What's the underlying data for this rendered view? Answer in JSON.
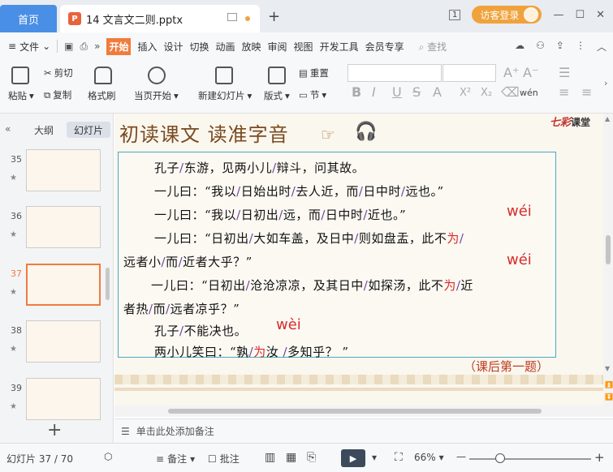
{
  "titlebar": {
    "home_label": "首页",
    "doc_icon": "P",
    "doc_name": "14 文言文二则.pptx",
    "new_tab": "+",
    "page_indicator": "1",
    "login_label": "访客登录",
    "minimize": "—",
    "maximize": "☐",
    "close": "✕"
  },
  "menubar": {
    "file_label": "文件",
    "tabs": [
      "开始",
      "插入",
      "设计",
      "切换",
      "动画",
      "放映",
      "审阅",
      "视图",
      "开发工具",
      "会员专享"
    ],
    "search_label": "查找"
  },
  "ribbon": {
    "paste": "粘贴",
    "cut": "剪切",
    "copy": "复制",
    "format_painter": "格式刷",
    "play_from_current": "当页开始",
    "new_slide": "新建幻灯片",
    "layout": "版式",
    "reset": "重置",
    "section": "节",
    "font_buttons": [
      "B",
      "I",
      "U",
      "S",
      "A",
      "X²",
      "X₂"
    ],
    "wen_label": "wén"
  },
  "leftpanel": {
    "collapse_icon": "«",
    "outline_tab": "大纲",
    "slides_tab": "幻灯片",
    "slides": [
      {
        "num": "35",
        "active": false
      },
      {
        "num": "36",
        "active": false
      },
      {
        "num": "37",
        "active": true
      },
      {
        "num": "38",
        "active": false
      },
      {
        "num": "39",
        "active": false
      }
    ],
    "add_slide": "+"
  },
  "slide": {
    "title": "初读课文 读准字音",
    "logo_main": "七彩",
    "logo_sub": "课堂",
    "lines": [
      {
        "parts": [
          [
            "孔子",
            "t"
          ],
          [
            "/",
            "s"
          ],
          [
            "东游，见两小儿",
            "t"
          ],
          [
            "/",
            "s"
          ],
          [
            "辩斗，问其故。",
            "t"
          ]
        ]
      },
      {
        "parts": [
          [
            "一儿曰：“我以",
            "t"
          ],
          [
            "/",
            "s"
          ],
          [
            "日始出时",
            "t"
          ],
          [
            "/",
            "s"
          ],
          [
            "去人近，而",
            "t"
          ],
          [
            "/",
            "s"
          ],
          [
            "日中时",
            "t"
          ],
          [
            "/",
            "s"
          ],
          [
            "远也。”",
            "t"
          ]
        ]
      },
      {
        "parts": [
          [
            "一儿曰：“我以",
            "t"
          ],
          [
            "/",
            "s"
          ],
          [
            "日初出",
            "t"
          ],
          [
            "/",
            "s"
          ],
          [
            "远，而",
            "t"
          ],
          [
            "/",
            "s"
          ],
          [
            "日中时",
            "t"
          ],
          [
            "/",
            "s"
          ],
          [
            "近也。”",
            "t"
          ]
        ]
      },
      {
        "parts": [
          [
            "一儿曰：“日初出",
            "t"
          ],
          [
            "/",
            "s"
          ],
          [
            "大如车盖，及日中",
            "t"
          ],
          [
            "/",
            "s"
          ],
          [
            "则如盘盂，此不",
            "t"
          ],
          [
            "为",
            "r"
          ],
          [
            "/",
            "s"
          ]
        ]
      },
      {
        "parts": [
          [
            "远者小",
            "t"
          ],
          [
            "/",
            "s"
          ],
          [
            "而",
            "t"
          ],
          [
            "/",
            "s"
          ],
          [
            "近者大乎？”",
            "t"
          ]
        ]
      },
      {
        "parts": [
          [
            "一儿曰：“日初出",
            "t"
          ],
          [
            "/",
            "s"
          ],
          [
            "沧沧凉凉，及其日中",
            "t"
          ],
          [
            "/",
            "s"
          ],
          [
            "如探汤，此不",
            "t"
          ],
          [
            "为",
            "r"
          ],
          [
            "/",
            "s"
          ],
          [
            "近",
            "t"
          ]
        ]
      },
      {
        "parts": [
          [
            "者热",
            "t"
          ],
          [
            "/",
            "s"
          ],
          [
            "而",
            "t"
          ],
          [
            "/",
            "s"
          ],
          [
            "远者凉乎？”",
            "t"
          ]
        ]
      },
      {
        "parts": [
          [
            "孔子",
            "t"
          ],
          [
            "/",
            "s"
          ],
          [
            "不能决也。",
            "t"
          ]
        ]
      },
      {
        "parts": [
          [
            "两小儿笑曰：“孰",
            "t"
          ],
          [
            "/",
            "s"
          ],
          [
            "为",
            "r"
          ],
          [
            "汝 ",
            "t"
          ],
          [
            "/",
            "s"
          ],
          [
            "多知乎？ ”",
            "t"
          ]
        ]
      }
    ],
    "pinyin": [
      "wéi",
      "wéi",
      "wèi"
    ],
    "after_class": "（课后第一题）"
  },
  "notes": {
    "placeholder": "单击此处添加备注"
  },
  "statusbar": {
    "slide_counter": "幻灯片 37 / 70",
    "notes_label": "备注",
    "comment_label": "批注",
    "zoom": "66%",
    "zoom_level": 0.25,
    "minus": "—",
    "plus": "+"
  }
}
